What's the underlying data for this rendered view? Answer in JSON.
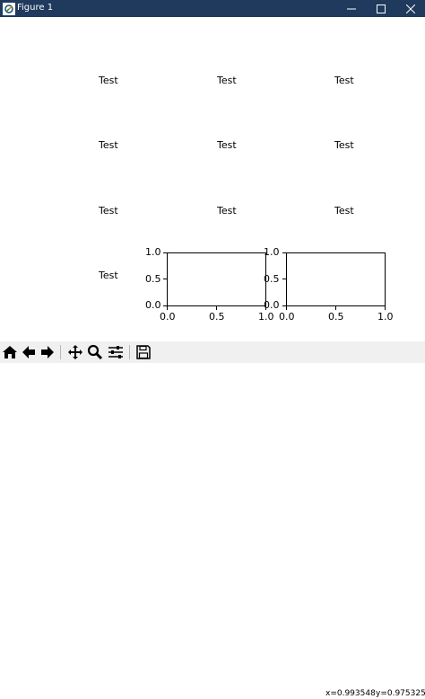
{
  "window": {
    "title": "Figure 1",
    "icon": "matplotlib-figure-icon",
    "controls": [
      "minimize-icon",
      "maximize-icon",
      "close-icon"
    ]
  },
  "figure": {
    "text_cells": [
      {
        "text": "Test"
      },
      {
        "text": "Test"
      },
      {
        "text": "Test"
      },
      {
        "text": "Test"
      },
      {
        "text": "Test"
      },
      {
        "text": "Test"
      },
      {
        "text": "Test"
      },
      {
        "text": "Test"
      },
      {
        "text": "Test"
      },
      {
        "text": "Test"
      }
    ],
    "axes_left": {
      "xticks": [
        "0.0",
        "0.5",
        "1.0"
      ],
      "yticks": [
        "1.0",
        "0.5",
        "0.0"
      ]
    },
    "axes_right": {
      "xticks": [
        "0.0",
        "0.5",
        "1.0"
      ],
      "yticks": [
        "1.0",
        "0.5",
        "0.0"
      ]
    }
  },
  "chart_data": [
    {
      "type": "line",
      "title": "",
      "xlabel": "",
      "ylabel": "",
      "xlim": [
        0.0,
        1.0
      ],
      "ylim": [
        0.0,
        1.0
      ],
      "series": [],
      "grid": false
    },
    {
      "type": "line",
      "title": "",
      "xlabel": "",
      "ylabel": "",
      "xlim": [
        0.0,
        1.0
      ],
      "ylim": [
        0.0,
        1.0
      ],
      "series": [],
      "grid": false
    }
  ],
  "toolbar": {
    "buttons": [
      {
        "icon": "home-icon"
      },
      {
        "icon": "back-arrow-icon"
      },
      {
        "icon": "forward-arrow-icon"
      },
      {
        "icon": "pan-icon"
      },
      {
        "icon": "zoom-icon"
      },
      {
        "icon": "configure-subplots-icon"
      },
      {
        "icon": "save-icon"
      }
    ],
    "coords": {
      "x": "x=0.993548",
      "y": "y=0.975325"
    }
  }
}
